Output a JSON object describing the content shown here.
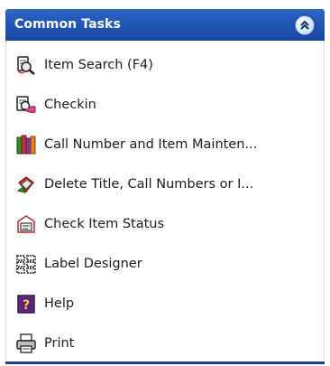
{
  "panel": {
    "title": "Common Tasks"
  },
  "tasks": [
    {
      "label": "Item Search (F4)",
      "icon": "item-search-icon"
    },
    {
      "label": "Checkin",
      "icon": "checkin-icon"
    },
    {
      "label": "Call Number and Item Mainten...",
      "icon": "books-icon"
    },
    {
      "label": "Delete Title, Call Numbers or I...",
      "icon": "delete-icon"
    },
    {
      "label": "Check Item Status",
      "icon": "item-status-icon"
    },
    {
      "label": "Label Designer",
      "icon": "label-grid-icon"
    },
    {
      "label": "Help",
      "icon": "help-icon"
    },
    {
      "label": "Print",
      "icon": "printer-icon"
    }
  ]
}
